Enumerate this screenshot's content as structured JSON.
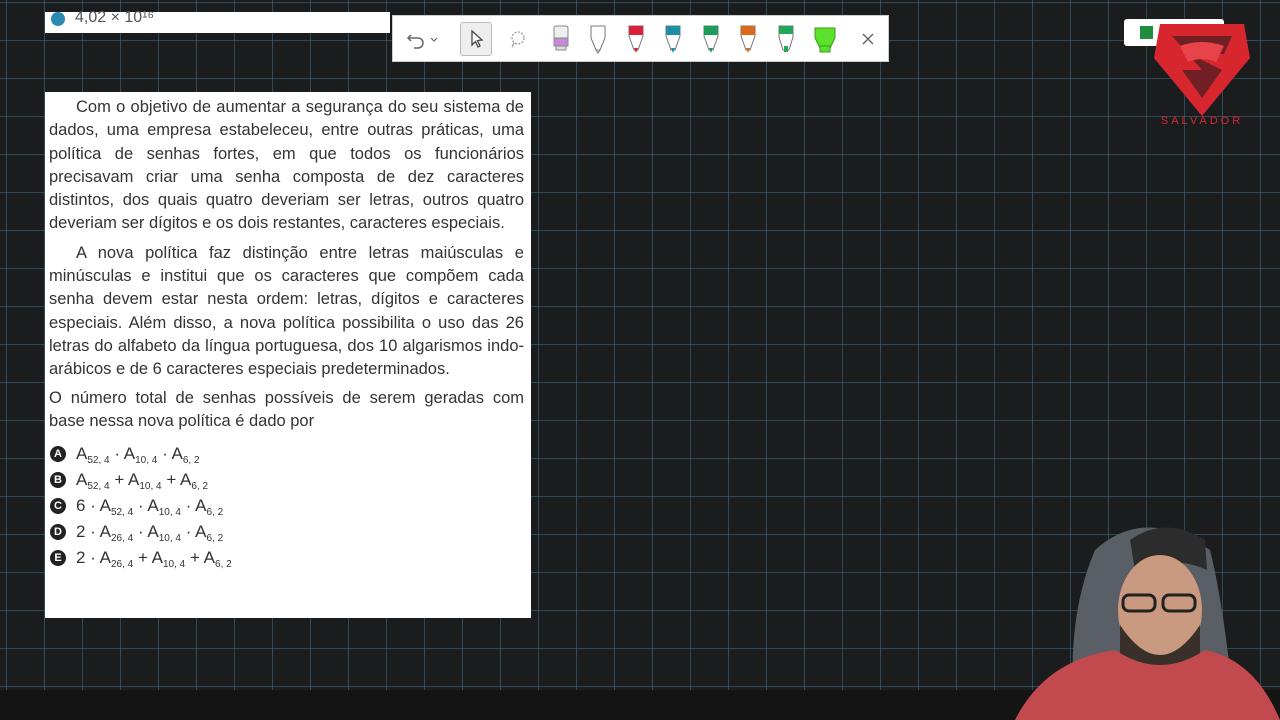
{
  "top_expression": "4,02 × 10¹⁶",
  "question": {
    "paragraph1": "Com o objetivo de aumentar a segurança do seu sistema de dados, uma empresa estabeleceu, entre outras práticas, uma política de senhas fortes, em que todos os funcionários precisavam criar uma senha composta de dez caracteres distintos, dos quais quatro deveriam ser letras, outros quatro deveriam ser dígitos e os dois restantes, caracteres especiais.",
    "paragraph2": "A nova política faz distinção entre letras maiúsculas e minúsculas e institui que os caracteres que compõem cada senha devem estar nesta ordem: letras, dígitos e caracteres especiais. Além disso, a nova política possibilita o uso das 26 letras do alfabeto da língua portuguesa, dos 10 algarismos indo-arábicos e de 6 caracteres especiais predeterminados.",
    "paragraph3": "O número total de senhas possíveis de serem geradas com base nessa nova política é dado por"
  },
  "options": {
    "a": {
      "letter": "A",
      "t1": "A",
      "s1": "52, 4",
      "t2": " · A",
      "s2": "10, 4",
      "t3": " · A",
      "s3": "6, 2"
    },
    "b": {
      "letter": "B",
      "t1": "A",
      "s1": "52, 4",
      "t2": " + A",
      "s2": "10, 4",
      "t3": " + A",
      "s3": "6, 2"
    },
    "c": {
      "letter": "C",
      "t1": "6 · A",
      "s1": "52, 4",
      "t2": " · A",
      "s2": "10, 4",
      "t3": " · A",
      "s3": "6, 2"
    },
    "d": {
      "letter": "D",
      "t1": "2 · A",
      "s1": "26, 4",
      "t2": " · A",
      "s2": "10, 4",
      "t3": " · A",
      "s3": "6, 2"
    },
    "e": {
      "letter": "E",
      "t1": "2 · A",
      "s1": "26, 4",
      "t2": " + A",
      "s2": "10, 4",
      "t3": " + A",
      "s3": "6, 2"
    }
  },
  "toolbar": {
    "tools": [
      "undo-icon",
      "undo-options-icon",
      "select-cursor-icon",
      "lasso-icon",
      "eraser-pen-icon",
      "white-pen-icon",
      "red-pen-icon",
      "teal-pen-icon",
      "green-pen-icon",
      "orange-pen-icon",
      "green-highlighter-icon",
      "lime-highlighter-icon",
      "close-icon"
    ],
    "pen_colors": {
      "eraser": "#c78bd6",
      "white": "#ffffff",
      "red": "#d9223a",
      "teal": "#1f8fa6",
      "green": "#1e9b5b",
      "orange": "#d86a1e",
      "green_hl": "#23a55a",
      "lime_hl": "#5be12c"
    }
  },
  "logo_text": "SALVADOR",
  "colors": {
    "background": "#1b1c1e",
    "grid": "#466e87",
    "logo_red": "#d7262e"
  }
}
